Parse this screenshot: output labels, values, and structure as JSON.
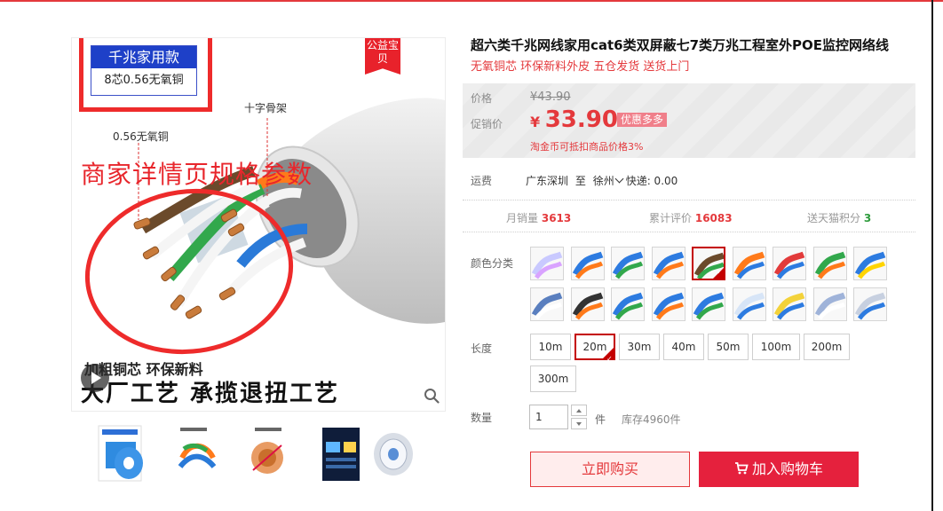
{
  "gallery": {
    "spec_badge": {
      "title": "千兆家用款",
      "subtitle": "8芯0.56无氧铜"
    },
    "ribbon": "公益宝贝",
    "callouts": {
      "skeleton": "十字骨架",
      "copper": "0.56无氧铜"
    },
    "overlay_text": "商家详情页规格参数",
    "caption_line1": "加粗铜芯 环保新料",
    "caption_line2": "大厂工艺 承揽退扭工艺",
    "thumbnail_count": 5
  },
  "product": {
    "title": "超六类千兆网线家用cat6类双屏蔽七7类万兆工程室外POE监控网络线",
    "subtitle": "无氧铜芯 环保新料外皮 五仓发货 送货上门"
  },
  "price": {
    "label": "价格",
    "original": "¥43.90",
    "promo_label": "促销价",
    "currency": "¥",
    "promo": "33.90",
    "badge": "优惠多多",
    "tmall_coin": "淘金币可抵扣商品价格3%"
  },
  "shipping": {
    "label": "运费",
    "from": "广东深圳",
    "to_word": "至",
    "to": "徐州",
    "express": "快递: 0.00"
  },
  "stats": {
    "monthly_label": "月销量",
    "monthly": "3613",
    "reviews_label": "累计评价",
    "reviews": "16083",
    "points_label": "送天猫积分",
    "points": "3"
  },
  "color": {
    "label": "颜色分类",
    "selected_index": 4,
    "swatch_count": 18
  },
  "length": {
    "label": "长度",
    "options": [
      "10m",
      "20m",
      "30m",
      "40m",
      "50m",
      "100m",
      "200m",
      "300m"
    ],
    "selected": "20m"
  },
  "quantity": {
    "label": "数量",
    "value": "1",
    "unit": "件",
    "stock": "库存4960件"
  },
  "actions": {
    "buy_now": "立即购买",
    "add_cart": "加入购物车"
  },
  "colors": {
    "accent": "#e4393c",
    "badge_blue": "#1e40c8",
    "cart_button": "#e5213d"
  }
}
